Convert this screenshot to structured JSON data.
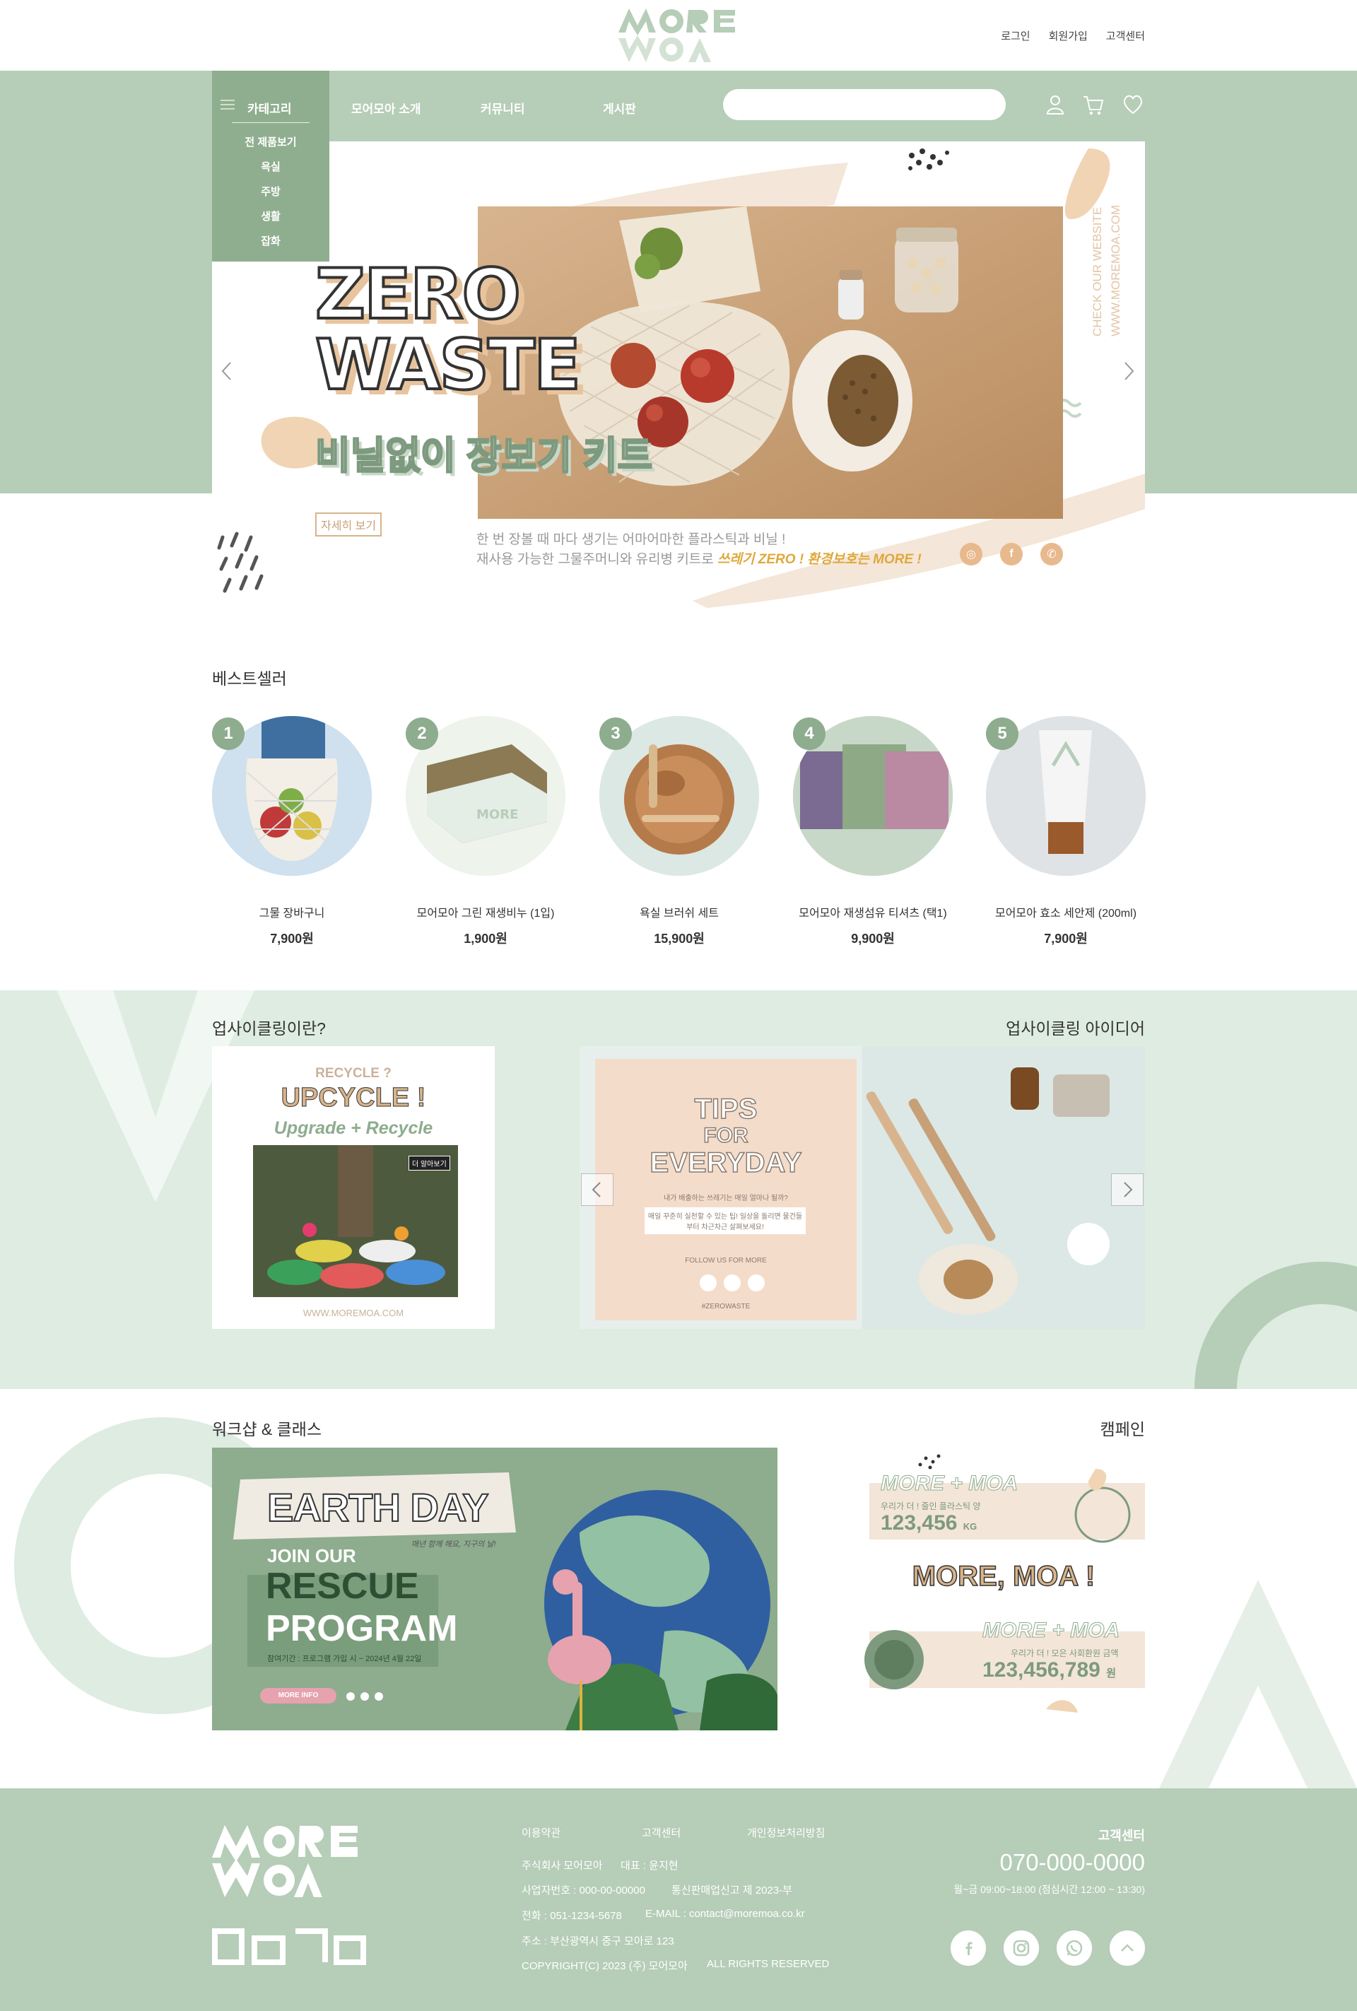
{
  "header": {
    "links": [
      "로그인",
      "회원가입",
      "고객센터"
    ]
  },
  "nav": {
    "category_label": "카테고리",
    "category_items": [
      "전 제품보기",
      "욕실",
      "주방",
      "생활",
      "잡화"
    ],
    "links": [
      "모어모아 소개",
      "커뮤니티",
      "게시판"
    ],
    "search_placeholder": ""
  },
  "hero": {
    "title_line1": "ZERO",
    "title_line2": "WASTE",
    "subtitle": "비닐없이 장보기 키트",
    "detail_button": "자세히 보기",
    "desc_line1": "한 번 장볼 때 마다 생기는 어마어마한 플라스틱과 비닐 !",
    "desc_line2_prefix": "재사용 가능한 그물주머니와 유리병 키트로 ",
    "desc_line2_highlight": "쓰레기 ZERO ! 환경보호는 MORE !",
    "vertical_line1": "CHECK OUR WEBSITE",
    "vertical_line2": "WWW.MOREMOA.COM"
  },
  "bestseller": {
    "title": "베스트셀러",
    "products": [
      {
        "rank": "1",
        "name": "그물 장바구니",
        "price": "7,900원"
      },
      {
        "rank": "2",
        "name": "모어모아 그린 재생비누 (1입)",
        "price": "1,900원"
      },
      {
        "rank": "3",
        "name": "욕실 브러쉬 세트",
        "price": "15,900원"
      },
      {
        "rank": "4",
        "name": "모어모아 재생섬유 티셔츠 (택1)",
        "price": "9,900원"
      },
      {
        "rank": "5",
        "name": "모어모아 효소 세안제 (200ml)",
        "price": "7,900원"
      }
    ]
  },
  "upcycling": {
    "left_title": "업사이클링이란?",
    "right_title": "업사이클링 아이디어",
    "card_recycle": "RECYCLE ?",
    "card_upcycle": "UPCYCLE !",
    "card_formula": "Upgrade + Recycle",
    "card_more": "더 알아보기",
    "card_url": "WWW.MOREMOA.COM",
    "tips_line1": "TIPS",
    "tips_line2": "FOR",
    "tips_line3": "EVERYDAY",
    "tips_q": "내가 배출하는 쓰레기는 매일 얼마나 될까?",
    "tips_body": "매일 꾸준히 실천할 수 있는 팁! 일상을 돌리면 물건들부터 차근차근 살펴보세요!",
    "tips_follow": "FOLLOW US FOR MORE",
    "tips_tag": "#ZEROWASTE"
  },
  "workshop": {
    "title": "워크샵 & 클래스",
    "earth_day": "EARTH DAY",
    "earth_sub": "매년 함께 해요, 지구의 날!",
    "join": "JOIN OUR",
    "rescue": "RESCUE",
    "program": "PROGRAM",
    "period": "참여기간 : 프로그램 가입 시 ~ 2024년 4월 22일",
    "more_info": "MORE INFO"
  },
  "campaign": {
    "title": "캠페인",
    "banner1_title": "MORE + MOA",
    "banner1_sub": "우리가 더 ! 줄인 플라스틱 양",
    "banner1_value": "123,456",
    "banner1_unit": "KG",
    "middle": "MORE, MOA !",
    "banner2_title": "MORE + MOA",
    "banner2_sub": "우리가 더 ! 모은 사회환원 금액",
    "banner2_value": "123,456,789",
    "banner2_unit": "원"
  },
  "footer": {
    "links": [
      "이용약관",
      "고객센터",
      "개인정보처리방침"
    ],
    "company": "주식회사 모어모아",
    "ceo": "대표 : 윤지현",
    "biz_no": "사업자번호 : 000-00-00000",
    "mail_order": "통신판매업신고 제 2023-부",
    "phone": "전화 : 051-1234-5678",
    "email": "E-MAIL : contact@moremoa.co.kr",
    "address": "주소 : 부산광역시 중구 모아로 123",
    "copyright": "COPYRIGHT(C) 2023 (주) 모어모아",
    "rights": "ALL RIGHTS RESERVED",
    "cs_label": "고객센터",
    "cs_phone": "070-000-0000",
    "cs_hours": "월~금 09:00~18:00 (점심시간 12:00 ~ 13:30)"
  },
  "colors": {
    "sage": "#b6cdb8",
    "sage_dark": "#8fae8f",
    "mint_bg": "#deece1",
    "beige": "#e8c49e",
    "peach": "#f4dccb"
  },
  "icons": [
    "menu-icon",
    "user-icon",
    "cart-icon",
    "heart-icon",
    "instagram-icon",
    "facebook-icon",
    "whatsapp-icon",
    "chevron-left-icon",
    "chevron-right-icon",
    "arrow-up-icon"
  ]
}
